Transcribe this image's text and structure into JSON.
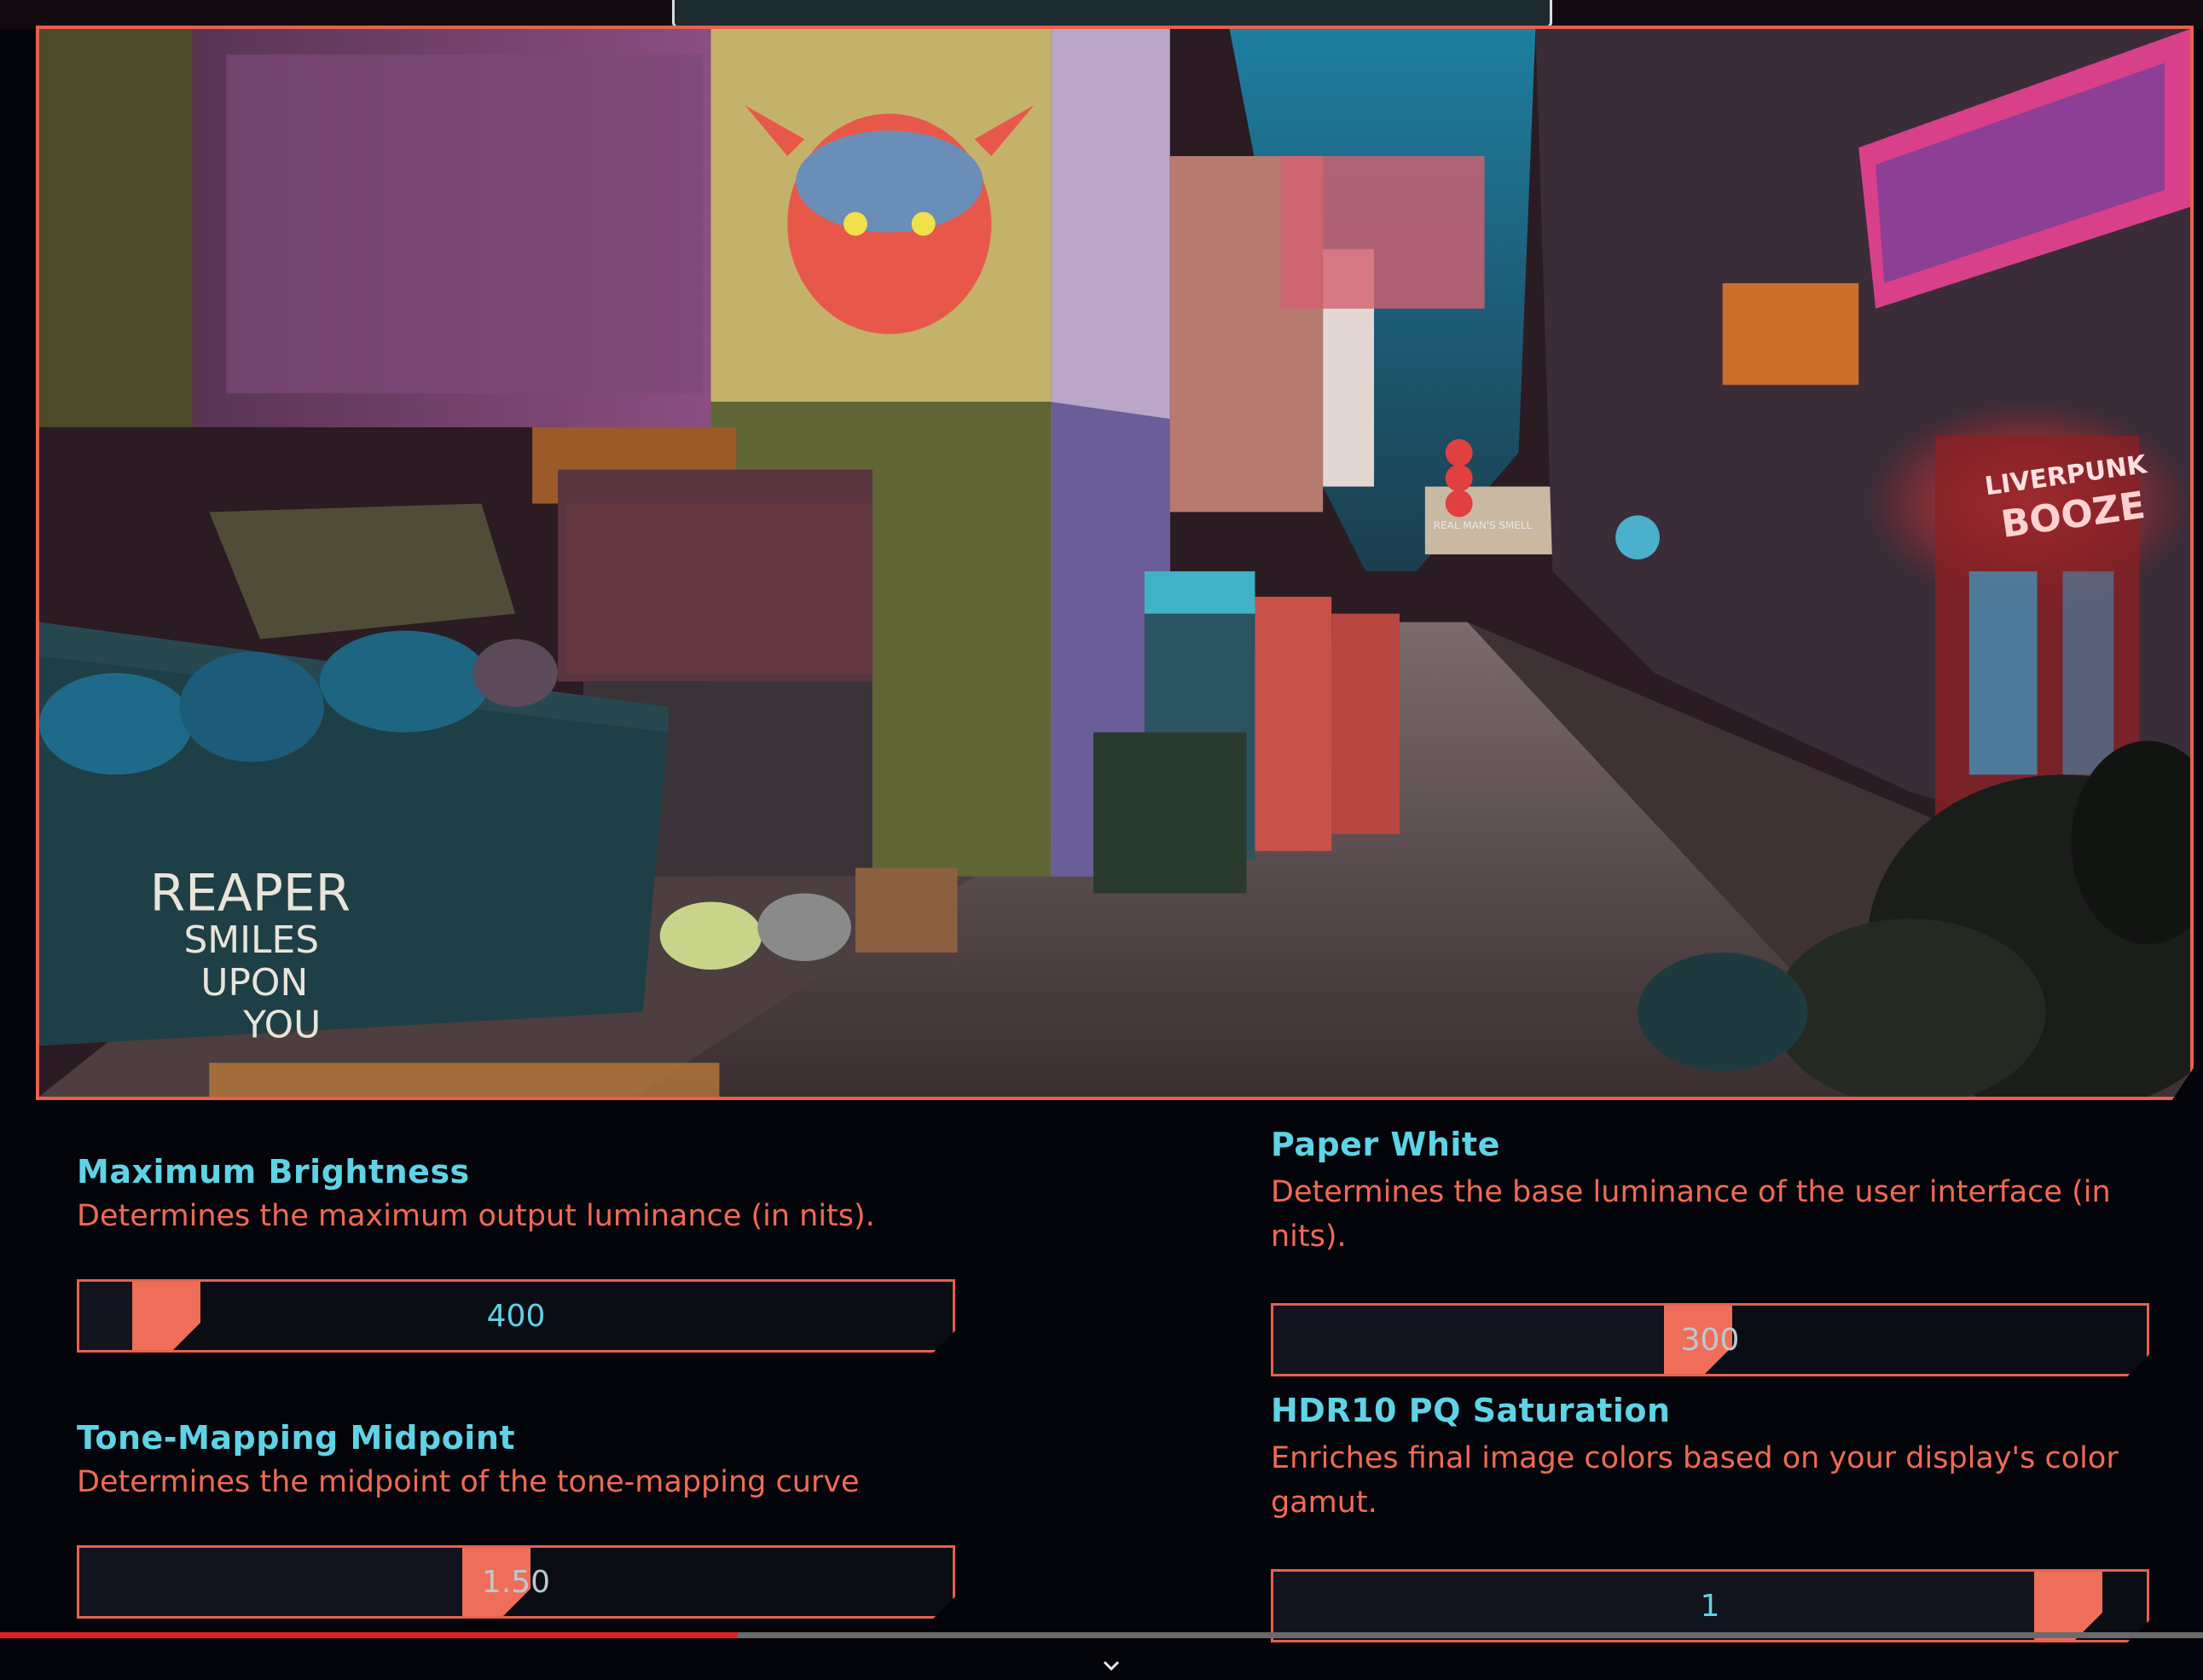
{
  "colors": {
    "accent": "#e8604e",
    "title": "#5fd3e6",
    "description": "#f06a55",
    "progress_played": "#e22020"
  },
  "preview_scene": {
    "graffiti_lines": [
      "REAPER",
      "SMILES",
      "UPON",
      "YOU"
    ],
    "neon_sign_lines": [
      "LIVERPUNK",
      "BOOZE"
    ],
    "street_sign": "REAL MAN'S SMELL"
  },
  "settings": {
    "max_brightness": {
      "title": "Maximum Brightness",
      "description": "Determines the maximum output luminance (in nits).",
      "value": "400",
      "fill_fraction": 0.04
    },
    "paper_white": {
      "title": "Paper White",
      "description": "Determines the base luminance of the user interface (in nits).",
      "value": "300",
      "fill_fraction": 0.46
    },
    "tone_mapping": {
      "title": "Tone-Mapping Midpoint",
      "description": "Determines the midpoint of the tone-mapping curve",
      "value": "1.50",
      "fill_fraction": 0.45
    },
    "hdr10_saturation": {
      "title": "HDR10 PQ Saturation",
      "description": "Enriches final image colors based on your display's color gamut.",
      "value": "1",
      "fill_fraction": 0.92
    }
  },
  "video": {
    "progress_fraction": 0.335,
    "controls_icon": "chevron-down-icon"
  }
}
